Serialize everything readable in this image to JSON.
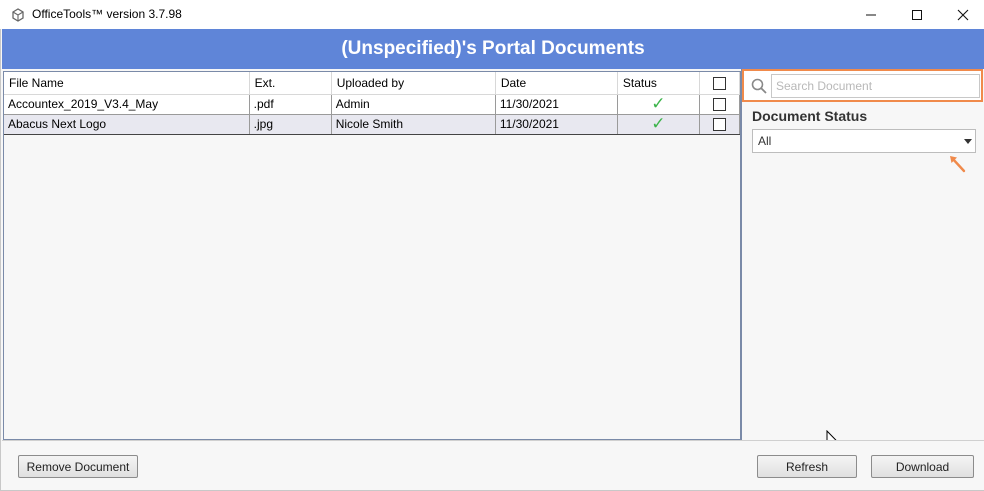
{
  "window": {
    "title": "OfficeTools™ version 3.7.98",
    "app_icon": "officetools-logo-icon",
    "controls": [
      "minimize-icon",
      "maximize-icon",
      "close-icon"
    ]
  },
  "header": {
    "title": "(Unspecified)'s Portal Documents",
    "background": "#5f85d8"
  },
  "grid": {
    "columns": [
      "File Name",
      "Ext.",
      "Uploaded by",
      "Date",
      "Status"
    ],
    "rows": [
      {
        "file_name": "Accountex_2019_V3.4_May",
        "ext": ".pdf",
        "uploaded_by": "Admin",
        "date": "11/30/2021",
        "status": "checkmark-icon",
        "checked": false
      },
      {
        "file_name": "Abacus Next Logo",
        "ext": ".jpg",
        "uploaded_by": "Nicole Smith",
        "date": "11/30/2021",
        "status": "checkmark-icon",
        "checked": false
      }
    ]
  },
  "filter": {
    "search_placeholder": "Search Document",
    "search_value": "",
    "highlight_color": "#f08a4b",
    "status_label": "Document Status",
    "status_value": "All"
  },
  "footer": {
    "remove_label": "Remove Document",
    "refresh_label": "Refresh",
    "download_label": "Download"
  }
}
